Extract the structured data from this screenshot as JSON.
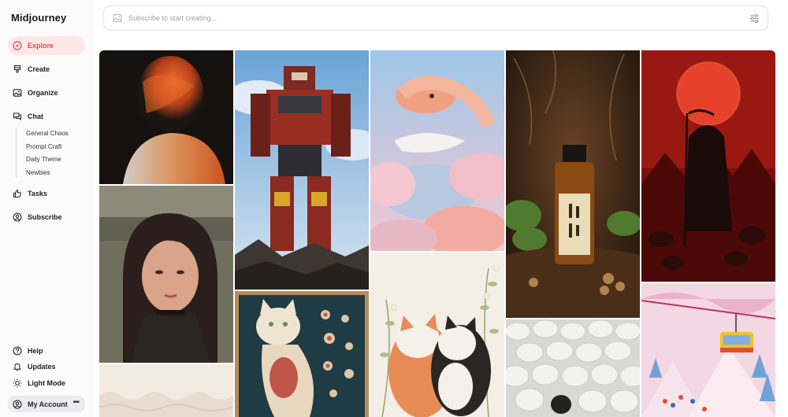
{
  "app": {
    "name": "Midjourney"
  },
  "sidebar": {
    "nav": [
      {
        "label": "Explore",
        "icon": "compass-icon",
        "active": true
      },
      {
        "label": "Create",
        "icon": "brush-icon"
      },
      {
        "label": "Organize",
        "icon": "image-icon"
      },
      {
        "label": "Chat",
        "icon": "chat-icon"
      }
    ],
    "chat_rooms": [
      "General Chaos",
      "Prompt Craft",
      "Daily Theme",
      "Newbies"
    ],
    "nav2": [
      {
        "label": "Tasks",
        "icon": "thumbs-up-icon"
      },
      {
        "label": "Subscribe",
        "icon": "user-circle-icon"
      }
    ],
    "footer": [
      {
        "label": "Help",
        "icon": "help-icon"
      },
      {
        "label": "Updates",
        "icon": "bell-icon"
      },
      {
        "label": "Light Mode",
        "icon": "sun-icon"
      }
    ],
    "account": {
      "label": "My Account",
      "icon": "user-circle-icon",
      "more": "•••"
    }
  },
  "search": {
    "placeholder": "Subscribe to start creating..."
  },
  "gallery": {
    "images": [
      {
        "subject": "blurred orange portrait"
      },
      {
        "subject": "giant robot"
      },
      {
        "subject": "pastel snake"
      },
      {
        "subject": "amber liquor bottle"
      },
      {
        "subject": "red moon reaper"
      },
      {
        "subject": "woman portrait"
      },
      {
        "subject": "cat anatomy chart"
      },
      {
        "subject": "two cats"
      },
      {
        "subject": "white sheep"
      },
      {
        "subject": "colorful gondola"
      },
      {
        "subject": "white lace"
      }
    ]
  },
  "colors": {
    "accent": "#e5484d",
    "accent_bg": "#fde8e7"
  }
}
